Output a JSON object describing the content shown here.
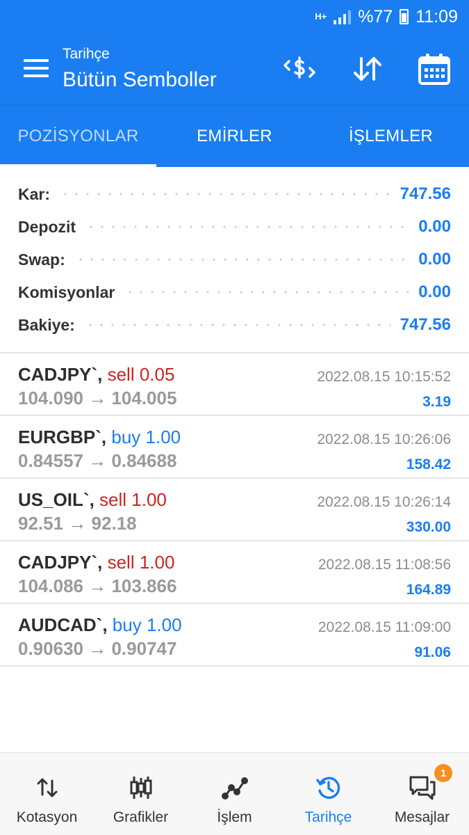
{
  "status_bar": {
    "network": "H+",
    "battery": "%77",
    "time": "11:09"
  },
  "header": {
    "subtitle": "Tarihçe",
    "title": "Bütün Semboller"
  },
  "header_icons": [
    "currency-exchange-icon",
    "sort-icon",
    "calendar-icon"
  ],
  "tabs": [
    {
      "label": "POZİSYONLAR",
      "active": true
    },
    {
      "label": "EMİRLER",
      "active": false
    },
    {
      "label": "İŞLEMLER",
      "active": false
    }
  ],
  "summary": [
    {
      "label": "Kar:",
      "value": "747.56"
    },
    {
      "label": "Depozit",
      "value": "0.00"
    },
    {
      "label": "Swap:",
      "value": "0.00"
    },
    {
      "label": "Komisyonlar",
      "value": "0.00"
    },
    {
      "label": "Bakiye:",
      "value": "747.56"
    }
  ],
  "deals": [
    {
      "symbol": "CADJPY`,",
      "type": "sell",
      "volume": "0.05",
      "open": "104.090",
      "arrow": "→",
      "close": "104.005",
      "time": "2022.08.15 10:15:52",
      "profit": "3.19"
    },
    {
      "symbol": "EURGBP`,",
      "type": "buy",
      "volume": "1.00",
      "open": "0.84557",
      "arrow": "→",
      "close": "0.84688",
      "time": "2022.08.15 10:26:06",
      "profit": "158.42"
    },
    {
      "symbol": "US_OIL`,",
      "type": "sell",
      "volume": "1.00",
      "open": "92.51",
      "arrow": "→",
      "close": "92.18",
      "time": "2022.08.15 10:26:14",
      "profit": "330.00"
    },
    {
      "symbol": "CADJPY`,",
      "type": "sell",
      "volume": "1.00",
      "open": "104.086",
      "arrow": "→",
      "close": "103.866",
      "time": "2022.08.15 11:08:56",
      "profit": "164.89"
    },
    {
      "symbol": "AUDCAD`,",
      "type": "buy",
      "volume": "1.00",
      "open": "0.90630",
      "arrow": "→",
      "close": "0.90747",
      "time": "2022.08.15 11:09:00",
      "profit": "91.06"
    }
  ],
  "bottom_nav": [
    {
      "label": "Kotasyon",
      "icon": "quotes-icon",
      "active": false
    },
    {
      "label": "Grafikler",
      "icon": "charts-icon",
      "active": false
    },
    {
      "label": "İşlem",
      "icon": "trade-icon",
      "active": false
    },
    {
      "label": "Tarihçe",
      "icon": "history-icon",
      "active": true
    },
    {
      "label": "Mesajlar",
      "icon": "messages-icon",
      "active": false,
      "badge": "1"
    }
  ],
  "colors": {
    "primary": "#1a7ef2",
    "sell": "#d0231e",
    "badge": "#f5901e"
  }
}
